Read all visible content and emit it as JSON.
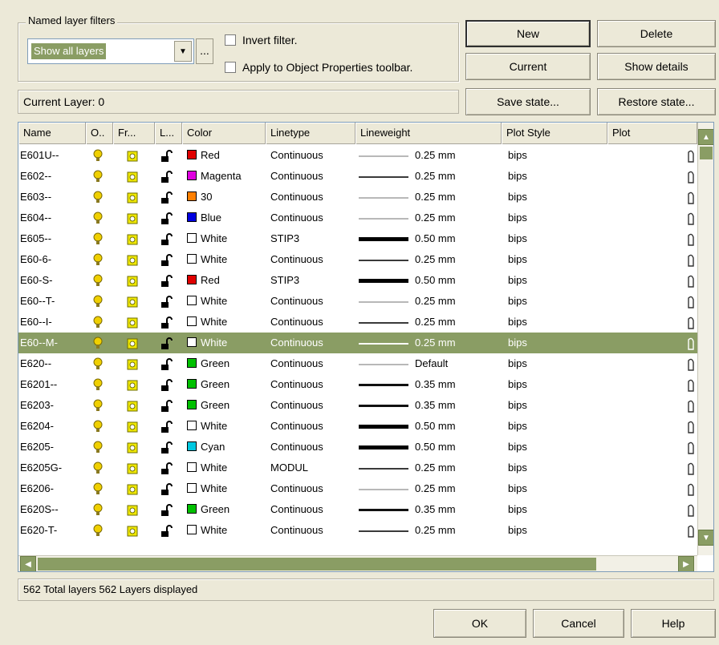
{
  "filters": {
    "group_label": "Named layer filters",
    "selected_filter": "Show all layers",
    "ellipsis": "...",
    "invert_label": "Invert filter.",
    "apply_label": "Apply to Object Properties toolbar."
  },
  "buttons": {
    "new": "New",
    "delete": "Delete",
    "current": "Current",
    "show_details": "Show details",
    "save_state": "Save state...",
    "restore_state": "Restore state...",
    "ok": "OK",
    "cancel": "Cancel",
    "help": "Help"
  },
  "current_layer": "Current Layer: 0",
  "columns": [
    "Name",
    "O..",
    "Fr...",
    "L...",
    "Color",
    "Linetype",
    "Lineweight",
    "Plot Style",
    "Plot"
  ],
  "layers": [
    {
      "name": "E601U--",
      "color": "Red",
      "swatch": "#e00000",
      "linetype": "Continuous",
      "lineweight": "0.25 mm",
      "lw_style": "light",
      "plot_style": "bips"
    },
    {
      "name": "E602--",
      "color": "Magenta",
      "swatch": "#e000e0",
      "linetype": "Continuous",
      "lineweight": "0.25 mm",
      "lw_style": "normal",
      "plot_style": "bips"
    },
    {
      "name": "E603--",
      "color": "30",
      "swatch": "#ff7f00",
      "linetype": "Continuous",
      "lineweight": "0.25 mm",
      "lw_style": "light",
      "plot_style": "bips"
    },
    {
      "name": "E604--",
      "color": "Blue",
      "swatch": "#0000e0",
      "linetype": "Continuous",
      "lineweight": "0.25 mm",
      "lw_style": "light",
      "plot_style": "bips"
    },
    {
      "name": "E605--",
      "color": "White",
      "swatch": "#ffffff",
      "linetype": "STIP3",
      "lineweight": "0.50 mm",
      "lw_style": "heavy",
      "plot_style": "bips"
    },
    {
      "name": "E60-6-",
      "color": "White",
      "swatch": "#ffffff",
      "linetype": "Continuous",
      "lineweight": "0.25 mm",
      "lw_style": "normal",
      "plot_style": "bips"
    },
    {
      "name": "E60-S-",
      "color": "Red",
      "swatch": "#e00000",
      "linetype": "STIP3",
      "lineweight": "0.50 mm",
      "lw_style": "heavy",
      "plot_style": "bips"
    },
    {
      "name": "E60--T-",
      "color": "White",
      "swatch": "#ffffff",
      "linetype": "Continuous",
      "lineweight": "0.25 mm",
      "lw_style": "light",
      "plot_style": "bips"
    },
    {
      "name": "E60--I-",
      "color": "White",
      "swatch": "#ffffff",
      "linetype": "Continuous",
      "lineweight": "0.25 mm",
      "lw_style": "normal",
      "plot_style": "bips"
    },
    {
      "name": "E60--M-",
      "color": "White",
      "swatch": "#ffffff",
      "linetype": "Continuous",
      "lineweight": "0.25 mm",
      "lw_style": "light",
      "plot_style": "bips",
      "selected": true
    },
    {
      "name": "E620--",
      "color": "Green",
      "swatch": "#00c000",
      "linetype": "Continuous",
      "lineweight": "Default",
      "lw_style": "light",
      "plot_style": "bips"
    },
    {
      "name": "E6201--",
      "color": "Green",
      "swatch": "#00c000",
      "linetype": "Continuous",
      "lineweight": "0.35 mm",
      "lw_style": "medium",
      "plot_style": "bips"
    },
    {
      "name": "E6203-",
      "color": "Green",
      "swatch": "#00c000",
      "linetype": "Continuous",
      "lineweight": "0.35 mm",
      "lw_style": "medium",
      "plot_style": "bips"
    },
    {
      "name": "E6204-",
      "color": "White",
      "swatch": "#ffffff",
      "linetype": "Continuous",
      "lineweight": "0.50 mm",
      "lw_style": "heavy",
      "plot_style": "bips"
    },
    {
      "name": "E6205-",
      "color": "Cyan",
      "swatch": "#00c8e0",
      "linetype": "Continuous",
      "lineweight": "0.50 mm",
      "lw_style": "heavy",
      "plot_style": "bips"
    },
    {
      "name": "E6205G-",
      "color": "White",
      "swatch": "#ffffff",
      "linetype": "MODUL",
      "lineweight": "0.25 mm",
      "lw_style": "normal",
      "plot_style": "bips"
    },
    {
      "name": "E6206-",
      "color": "White",
      "swatch": "#ffffff",
      "linetype": "Continuous",
      "lineweight": "0.25 mm",
      "lw_style": "light",
      "plot_style": "bips"
    },
    {
      "name": "E620S--",
      "color": "Green",
      "swatch": "#00c000",
      "linetype": "Continuous",
      "lineweight": "0.35 mm",
      "lw_style": "medium",
      "plot_style": "bips"
    },
    {
      "name": "E620-T-",
      "color": "White",
      "swatch": "#ffffff",
      "linetype": "Continuous",
      "lineweight": "0.25 mm",
      "lw_style": "normal",
      "plot_style": "bips"
    }
  ],
  "status": "562 Total layers 562 Layers displayed",
  "icons": {
    "on": "lightbulb-icon",
    "freeze": "sun-icon",
    "lock": "unlock-icon",
    "plot": "printer-icon",
    "combo_arrow": "chevron-down-icon"
  },
  "colors": {
    "selection": "#8a9d64",
    "bulb": "#f0d000",
    "sun": "#f0e800"
  }
}
